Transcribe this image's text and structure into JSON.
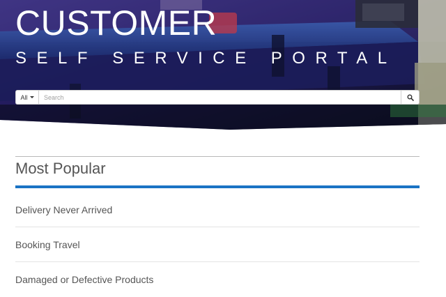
{
  "hero": {
    "title": "CUSTOMER",
    "subtitle": "SELF SERVICE PORTAL"
  },
  "search": {
    "scope_label": "All",
    "placeholder": "Search",
    "value": "",
    "button_icon": "search-icon"
  },
  "popular": {
    "heading": "Most Popular",
    "items": [
      {
        "label": "Delivery Never Arrived"
      },
      {
        "label": "Booking Travel"
      },
      {
        "label": "Damaged or Defective Products"
      }
    ]
  },
  "colors": {
    "accent": "#1a73c4",
    "text": "#555555",
    "hero_tint": "#2a1f6e"
  }
}
